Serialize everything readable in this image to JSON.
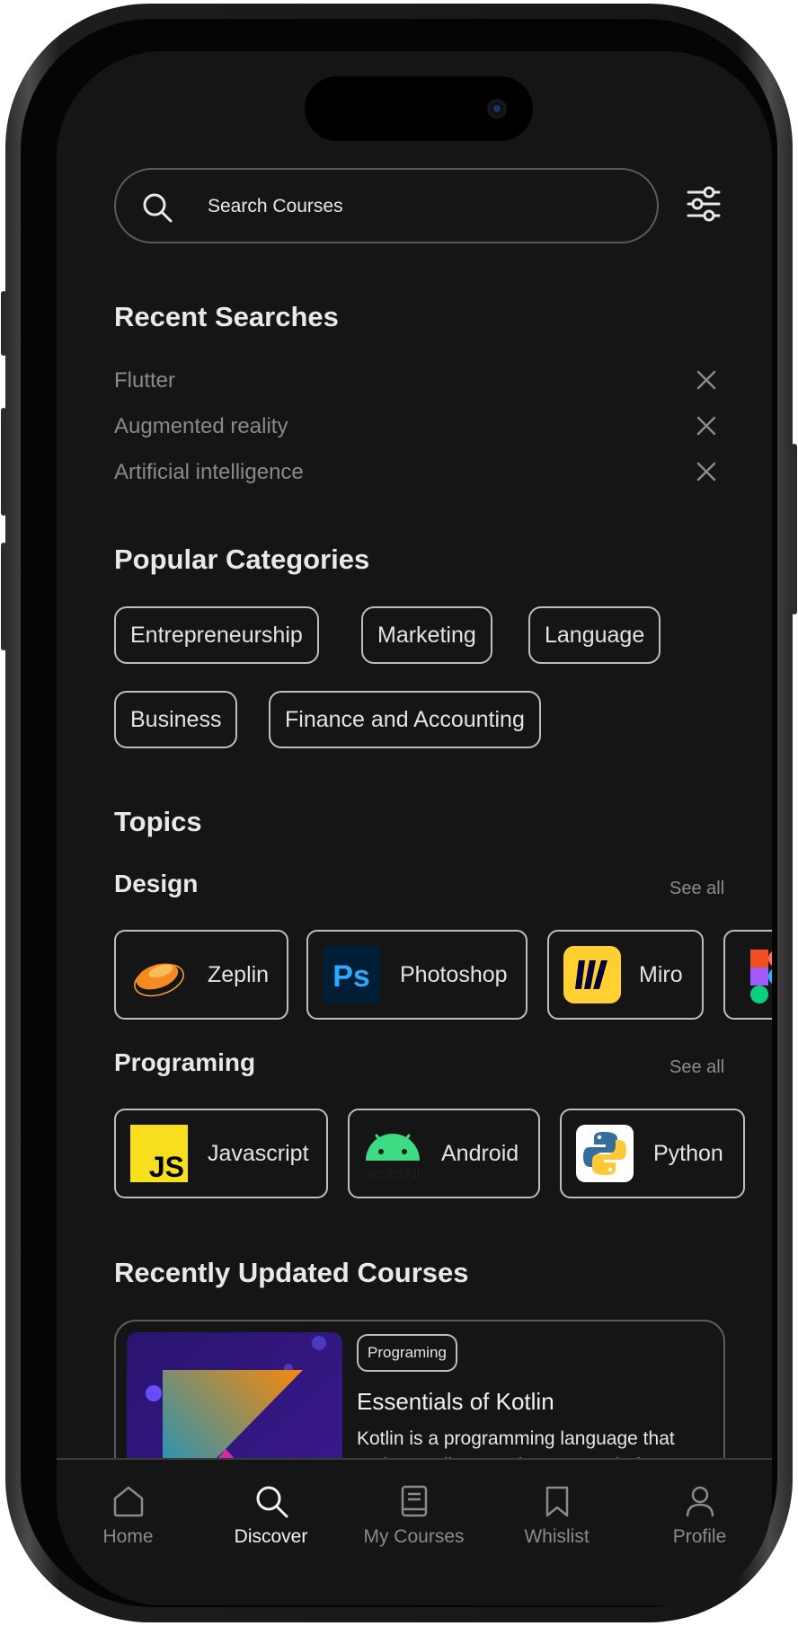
{
  "search": {
    "placeholder": "Search Courses"
  },
  "recent": {
    "title": "Recent Searches",
    "items": [
      "Flutter",
      "Augmented reality",
      "Artificial intelligence"
    ]
  },
  "categories": {
    "title": "Popular Categories",
    "items": [
      "Entrepreneurship",
      "Marketing",
      "Language",
      "Business",
      "Finance and Accounting"
    ]
  },
  "topics": {
    "title": "Topics",
    "design": {
      "title": "Design",
      "see_all": "See all",
      "items": [
        {
          "label": "Zeplin",
          "icon": "zeplin-icon"
        },
        {
          "label": "Photoshop",
          "icon": "photoshop-icon"
        },
        {
          "label": "Miro",
          "icon": "miro-icon"
        },
        {
          "label": "",
          "icon": "figma-icon"
        }
      ]
    },
    "programming": {
      "title": "Programing",
      "see_all": "See all",
      "items": [
        {
          "label": "Javascript",
          "icon": "javascript-icon"
        },
        {
          "label": "Android",
          "icon": "android-icon"
        },
        {
          "label": "Python",
          "icon": "python-icon"
        }
      ]
    }
  },
  "recently_updated": {
    "title": "Recently Updated Courses",
    "course": {
      "badge": "Programing",
      "title": "Essentials of Kotlin",
      "description": "Kotlin is a programming language that makes coding concise, cross-platform"
    }
  },
  "icon_text": {
    "photoshop": "Ps",
    "javascript": "JS",
    "android": "android"
  },
  "tabbar": {
    "items": [
      {
        "label": "Home",
        "icon": "home-icon",
        "active": false
      },
      {
        "label": "Discover",
        "icon": "search-icon",
        "active": true
      },
      {
        "label": "My Courses",
        "icon": "book-icon",
        "active": false
      },
      {
        "label": "Whislist",
        "icon": "bookmark-icon",
        "active": false
      },
      {
        "label": "Profile",
        "icon": "profile-icon",
        "active": false
      }
    ]
  },
  "colors": {
    "background": "#151515",
    "text_primary": "#e9e9e9",
    "text_muted": "#8a8a8a",
    "chip_border": "#bdbdbd"
  }
}
